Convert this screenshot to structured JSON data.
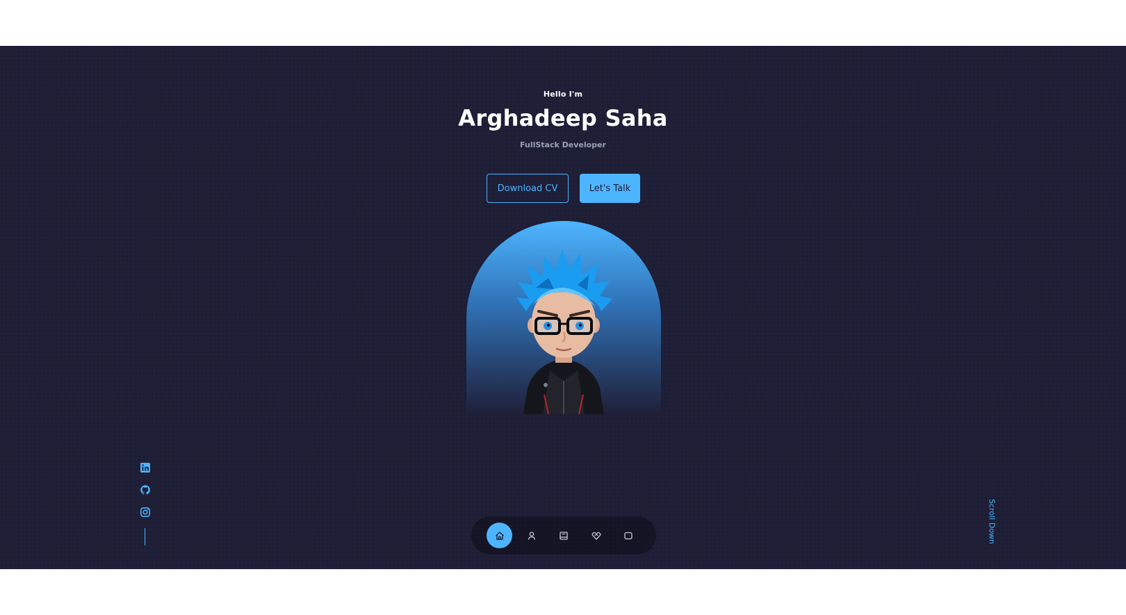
{
  "hero": {
    "greeting": "Hello I'm",
    "name": "Arghadeep Saha",
    "role": "FullStack Developer"
  },
  "buttons": {
    "download_cv": "Download CV",
    "lets_talk": "Let's Talk"
  },
  "portrait": {
    "icon": "avatar-illustration"
  },
  "socials": [
    {
      "icon": "linkedin-icon"
    },
    {
      "icon": "github-icon"
    },
    {
      "icon": "instagram-icon"
    }
  ],
  "nav": {
    "items": [
      {
        "icon": "home-icon",
        "active": true
      },
      {
        "icon": "user-icon",
        "active": false
      },
      {
        "icon": "book-icon",
        "active": false
      },
      {
        "icon": "services-icon",
        "active": false
      },
      {
        "icon": "message-icon",
        "active": false
      }
    ]
  },
  "scroll": {
    "label": "Scroll Down"
  },
  "colors": {
    "background": "#1f1f38",
    "accent": "#4db5ff",
    "text": "#ffffff",
    "muted": "#9aa0b4"
  }
}
